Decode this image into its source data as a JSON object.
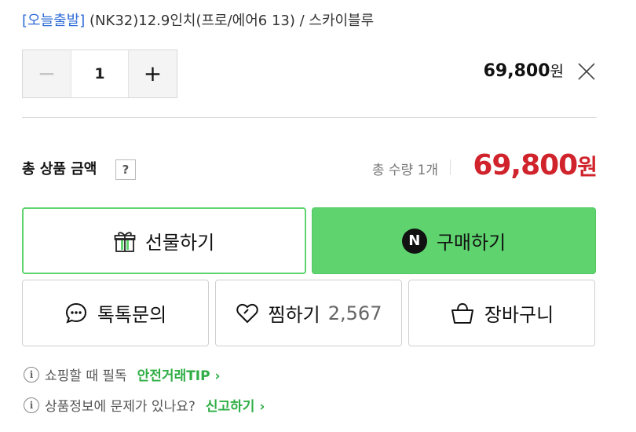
{
  "option": {
    "tag": "[오늘출발]",
    "title": "(NK32)12.9인치(프로/에어6 13) / 스카이블루"
  },
  "quantity": {
    "value": "1",
    "minus_icon": "minus-icon",
    "plus_icon": "plus-icon"
  },
  "line_price": {
    "amount": "69,800",
    "unit": "원"
  },
  "total": {
    "label": "총 상품 금액",
    "help": "?",
    "qty_text": "총 수량 1개",
    "amount": "69,800",
    "unit": "원"
  },
  "buttons": {
    "gift": "선물하기",
    "buy": "구매하기",
    "buy_badge": "N",
    "talk": "톡톡문의",
    "zzim": "찜하기",
    "zzim_count": "2,567",
    "cart": "장바구니"
  },
  "notices": [
    {
      "text": "쇼핑할 때 필독",
      "link": "안전거래TIP"
    },
    {
      "text": "상품정보에 문제가 있나요?",
      "link": "신고하기"
    }
  ],
  "colors": {
    "accent_green": "#5ed36e",
    "price_red": "#d0232b",
    "tag_blue": "#2d6bd6",
    "link_green": "#2fae45"
  }
}
